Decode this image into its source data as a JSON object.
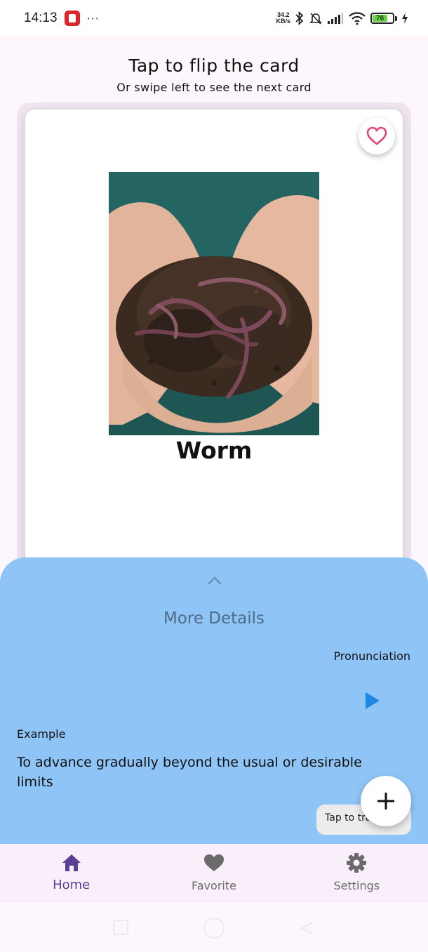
{
  "status_bar": {
    "time": "14:13",
    "dots": "···",
    "net_speed_value": "34.2",
    "net_speed_unit": "KB/s",
    "battery_level": "76"
  },
  "header": {
    "title": "Tap to flip the card",
    "subtitle": "Or swipe left to see the next card"
  },
  "card": {
    "word": "Worm",
    "image_subject": "hands-holding-soil-with-earthworms"
  },
  "details": {
    "title": "More Details",
    "pronunciation_label": "Pronunciation",
    "example_label": "Example",
    "example_text": "To advance gradually beyond the usual or desirable limits",
    "tap_translate_label": "Tap to translate"
  },
  "bottom_nav": {
    "items": [
      {
        "label": "Home",
        "icon": "home-icon",
        "active": true
      },
      {
        "label": "Favorite",
        "icon": "heart-icon",
        "active": false
      },
      {
        "label": "Settings",
        "icon": "gear-icon",
        "active": false
      }
    ]
  },
  "colors": {
    "details_panel": "#8fc4f7",
    "accent_purple": "#5b3f94",
    "heart_pink": "#e0457b",
    "play_blue": "#1e88e5"
  }
}
